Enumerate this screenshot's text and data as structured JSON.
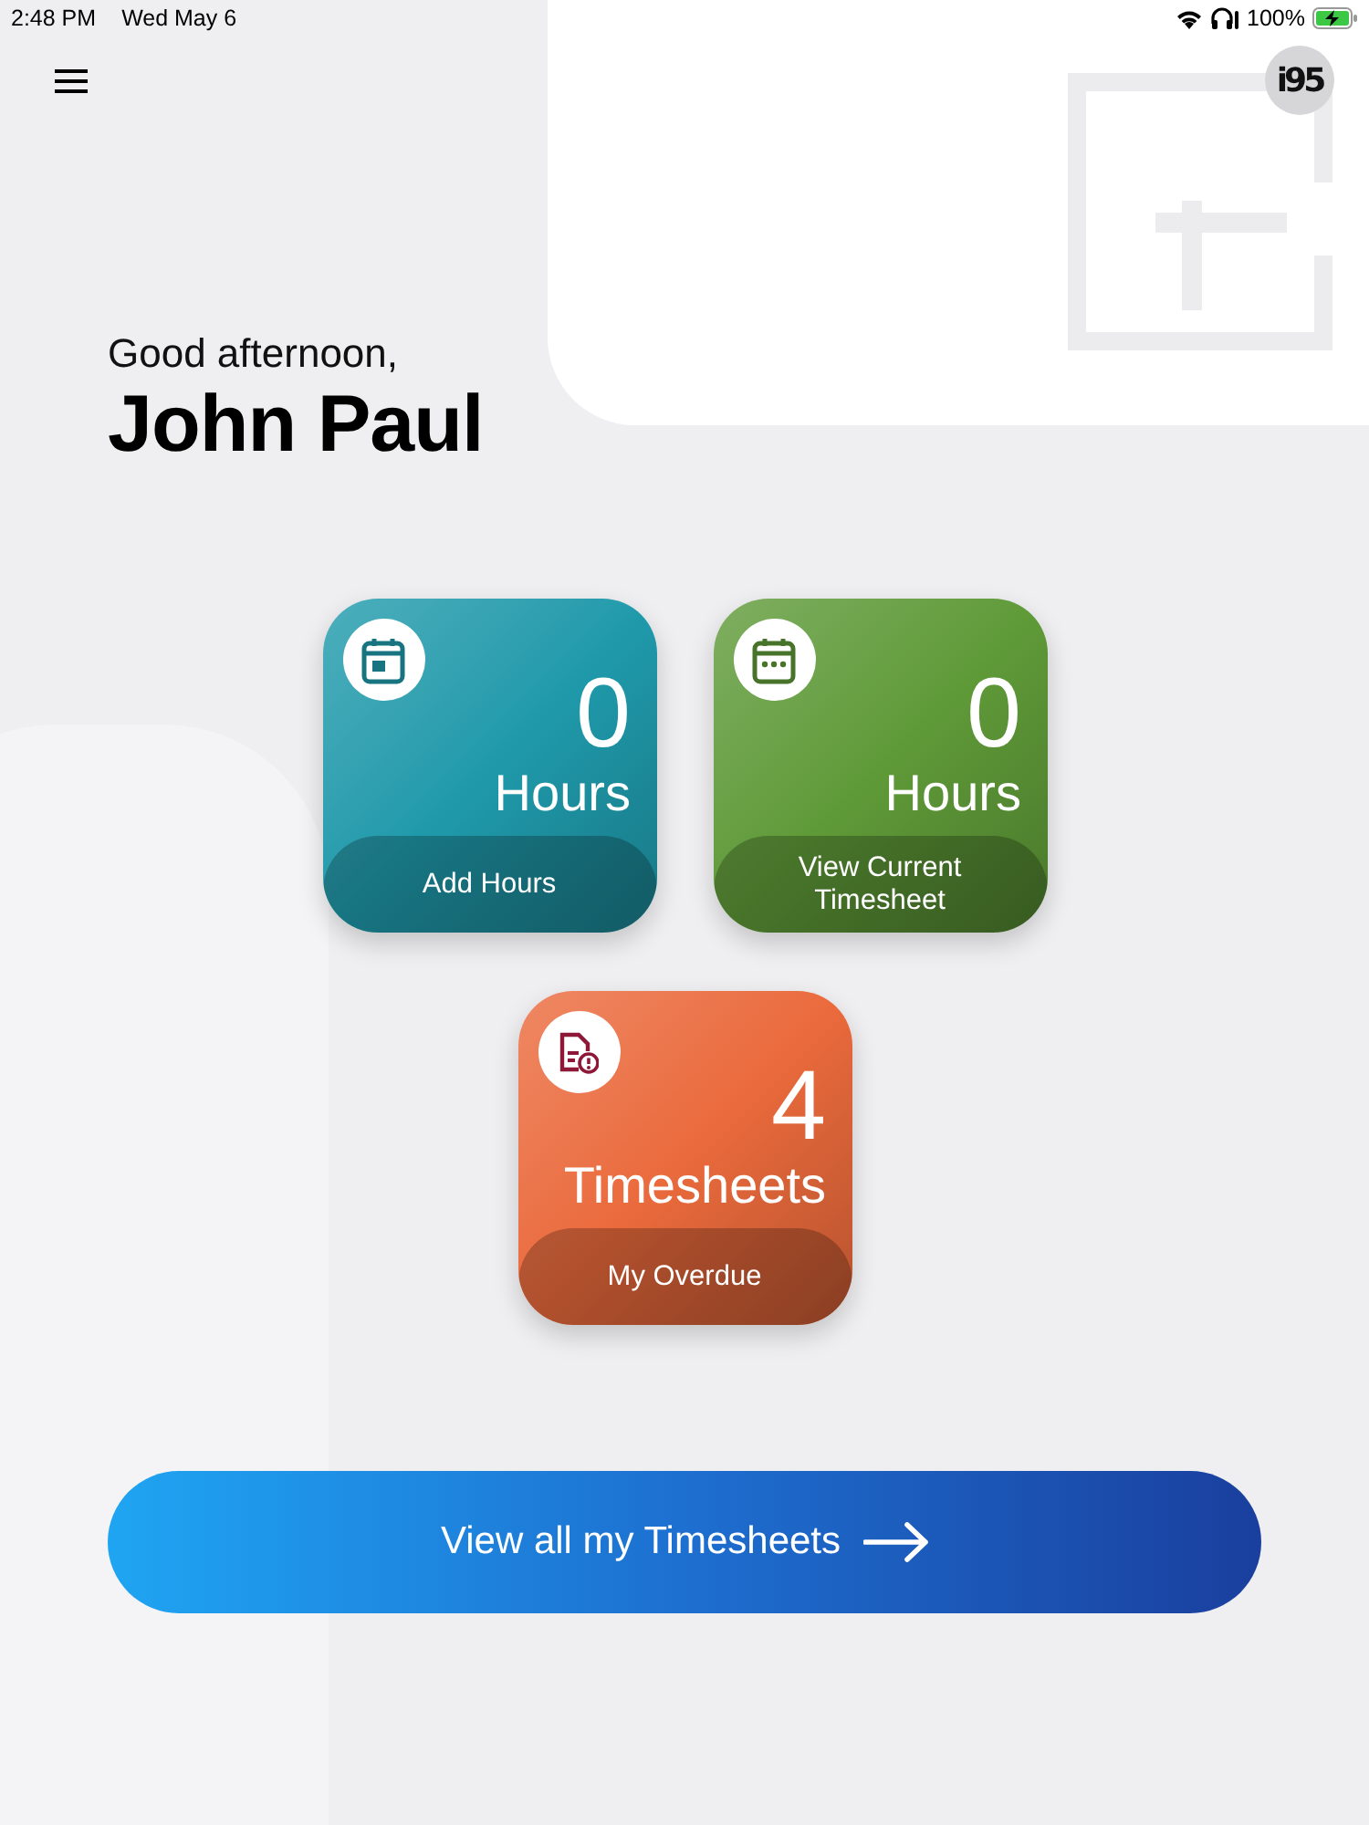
{
  "status_bar": {
    "time": "2:48 PM",
    "date": "Wed May 6",
    "battery": "100%"
  },
  "header": {
    "avatar": "i95"
  },
  "greeting": {
    "salutation": "Good afternoon,",
    "name": "John Paul"
  },
  "tiles": [
    {
      "kind": "add",
      "count": "0",
      "unit": "Hours",
      "action": "Add Hours",
      "color": "#1f9aab"
    },
    {
      "kind": "view",
      "count": "0",
      "unit": "Hours",
      "action": "View Current Timesheet",
      "color": "#5f9a38"
    },
    {
      "kind": "overdue",
      "count": "4",
      "unit": "Timesheets",
      "action": "My Overdue",
      "color": "#ea6a3c"
    }
  ],
  "cta": {
    "label": "View all my Timesheets"
  }
}
